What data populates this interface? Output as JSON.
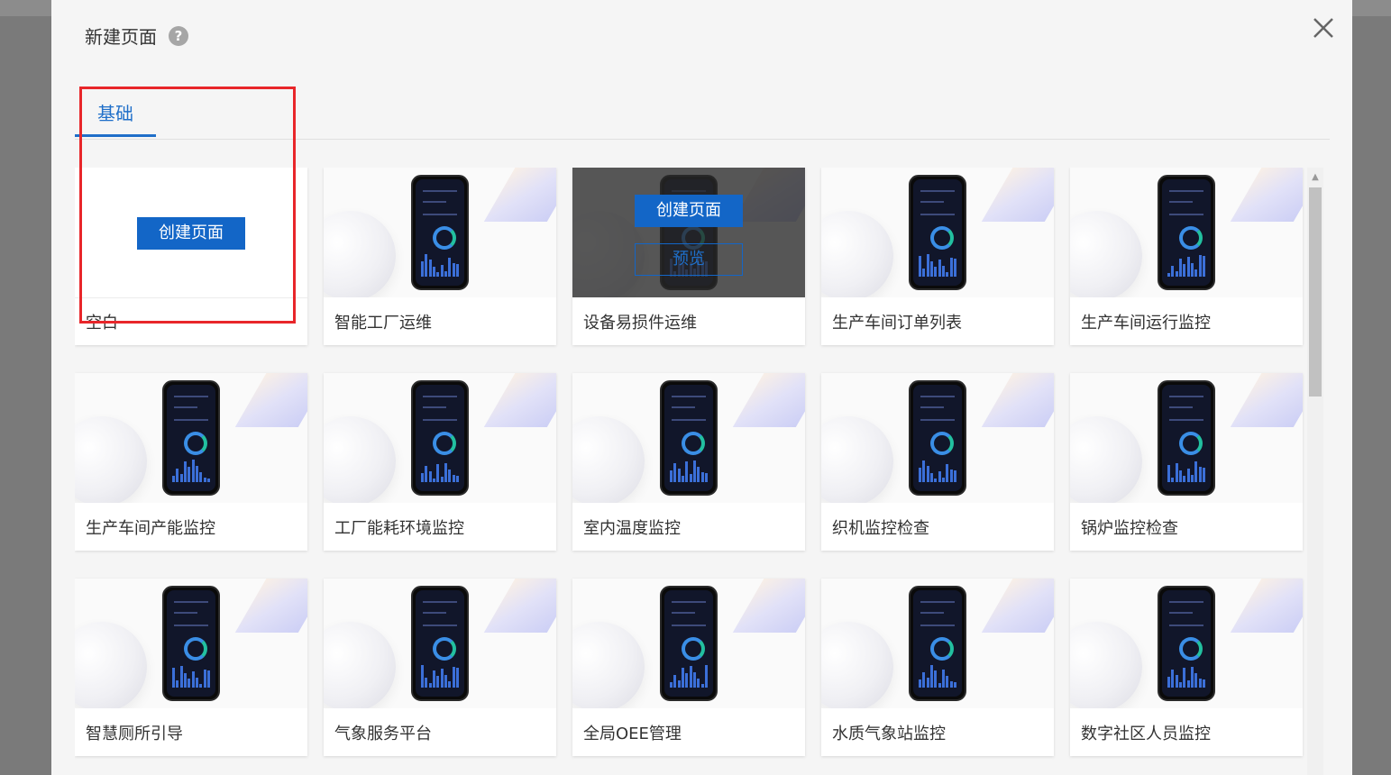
{
  "dialog": {
    "title": "新建页面",
    "help_symbol": "?",
    "close_symbol": "×"
  },
  "tabs": [
    {
      "label": "基础",
      "active": true
    }
  ],
  "card_actions": {
    "create_label": "创建页面",
    "preview_label": "预览"
  },
  "cards": [
    {
      "label": "空白",
      "type": "blank"
    },
    {
      "label": "智能工厂运维"
    },
    {
      "label": "设备易损件运维",
      "hovered": true
    },
    {
      "label": "生产车间订单列表"
    },
    {
      "label": "生产车间运行监控"
    },
    {
      "label": "生产车间产能监控"
    },
    {
      "label": "工厂能耗环境监控"
    },
    {
      "label": "室内温度监控"
    },
    {
      "label": "织机监控检查"
    },
    {
      "label": "锅炉监控检查"
    },
    {
      "label": "智慧厕所引导"
    },
    {
      "label": "气象服务平台"
    },
    {
      "label": "全局OEE管理"
    },
    {
      "label": "水质气象站监控"
    },
    {
      "label": "数字社区人员监控"
    }
  ],
  "colors": {
    "accent": "#1366c7",
    "highlight_box": "#e8262a"
  }
}
